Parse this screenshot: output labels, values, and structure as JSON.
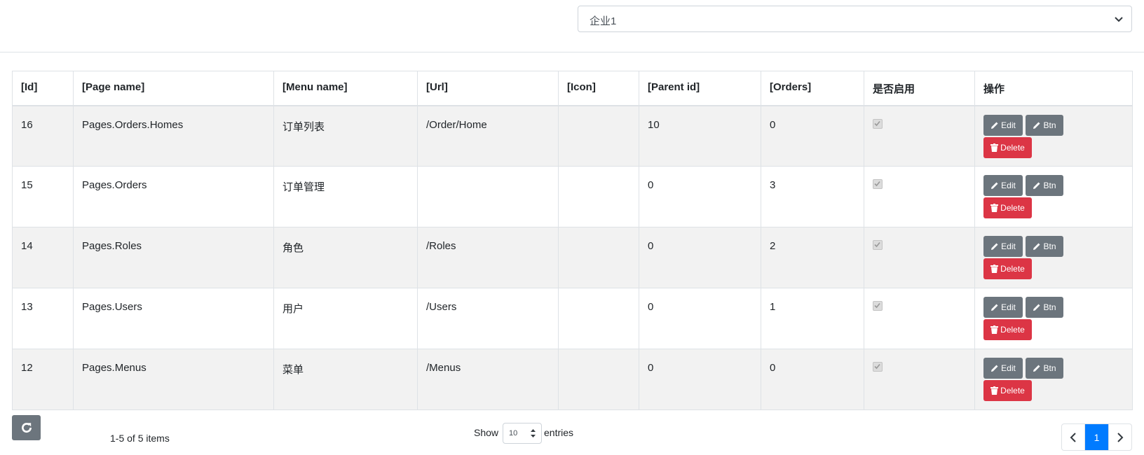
{
  "tenant_select": {
    "value": "企业1"
  },
  "table": {
    "headers": [
      "[Id]",
      "[Page name]",
      "[Menu name]",
      "[Url]",
      "[Icon]",
      "[Parent id]",
      "[Orders]",
      "是否启用",
      "操作"
    ],
    "rows": [
      {
        "id": "16",
        "page_name": "Pages.Orders.Homes",
        "menu_name": "订单列表",
        "url": "/Order/Home",
        "icon": "",
        "parent_id": "10",
        "orders": "0",
        "enabled": true
      },
      {
        "id": "15",
        "page_name": "Pages.Orders",
        "menu_name": "订单管理",
        "url": "",
        "icon": "",
        "parent_id": "0",
        "orders": "3",
        "enabled": true
      },
      {
        "id": "14",
        "page_name": "Pages.Roles",
        "menu_name": "角色",
        "url": "/Roles",
        "icon": "",
        "parent_id": "0",
        "orders": "2",
        "enabled": true
      },
      {
        "id": "13",
        "page_name": "Pages.Users",
        "menu_name": "用户",
        "url": "/Users",
        "icon": "",
        "parent_id": "0",
        "orders": "1",
        "enabled": true
      },
      {
        "id": "12",
        "page_name": "Pages.Menus",
        "menu_name": "菜单",
        "url": "/Menus",
        "icon": "",
        "parent_id": "0",
        "orders": "0",
        "enabled": true
      }
    ],
    "actions": {
      "edit": "Edit",
      "btn": "Btn",
      "delete": "Delete"
    }
  },
  "footer": {
    "items_info": "1-5 of 5 items",
    "show_label": "Show",
    "page_size": "10",
    "entries_label": "entries",
    "current_page": "1"
  },
  "icons": {
    "select_chevron": "chevron-down-icon",
    "refresh": "refresh-icon",
    "edit": "pencil-icon",
    "delete": "trash-icon",
    "prev": "chevron-left-icon",
    "next": "chevron-right-icon"
  },
  "colors": {
    "secondary": "#6c757d",
    "danger": "#dc3545",
    "primary": "#007bff",
    "stripe": "#f2f2f2"
  }
}
